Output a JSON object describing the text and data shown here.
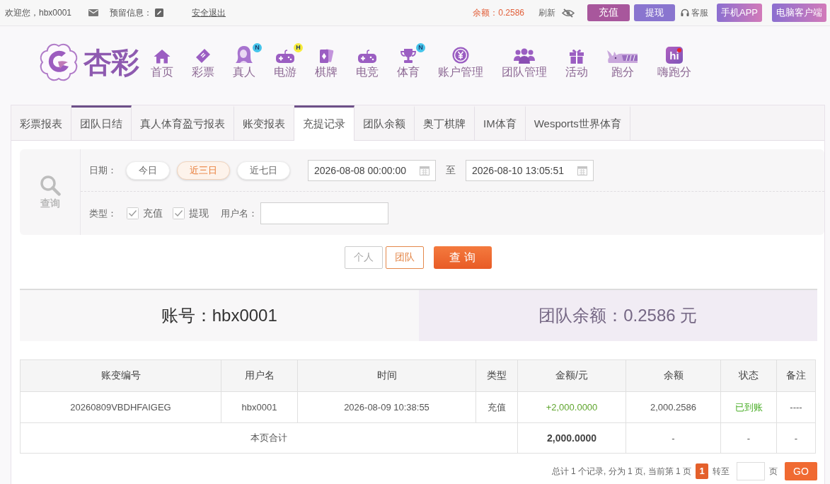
{
  "top_bar": {
    "welcome": "欢迎您，hbx0001",
    "message_label": "预留信息：",
    "logout": "安全退出",
    "balance": "余额：0.2586",
    "refresh": "刷新",
    "actions": [
      {
        "kind": "deposit",
        "label": "充值"
      },
      {
        "kind": "withdraw",
        "label": "提现"
      },
      {
        "kind": "support",
        "label": "客服"
      },
      {
        "kind": "app",
        "label": "手机APP"
      },
      {
        "kind": "app",
        "label": "电脑客户端"
      }
    ]
  },
  "logo": {
    "text": "杏彩"
  },
  "nav": [
    {
      "kind": "home",
      "label": "首页"
    },
    {
      "kind": "ticket",
      "label": "彩票"
    },
    {
      "kind": "live",
      "label": "真人",
      "badge": {
        "text": "N",
        "color": "#45c4ea"
      }
    },
    {
      "kind": "gamepad",
      "label": "电游",
      "badge": {
        "text": "H",
        "color": "#f7ec3a"
      }
    },
    {
      "kind": "cards",
      "label": "棋牌"
    },
    {
      "kind": "gamepad",
      "label": "电竞"
    },
    {
      "kind": "trophy",
      "label": "体育",
      "badge": {
        "text": "N",
        "color": "#45c4ea"
      }
    },
    {
      "kind": "coin",
      "label": "账户管理"
    },
    {
      "kind": "team",
      "label": "团队管理"
    },
    {
      "kind": "gift",
      "label": "活动"
    },
    {
      "kind": "rhino",
      "label": "跑分"
    },
    {
      "kind": "hi_app",
      "label": "嗨跑分",
      "icon_text": "hi"
    }
  ],
  "tabs": [
    {
      "label": "彩票报表",
      "selected": false,
      "hovered": false
    },
    {
      "label": "团队日结",
      "selected": false,
      "hovered": true
    },
    {
      "label": "真人体育盈亏报表",
      "selected": false,
      "hovered": false
    },
    {
      "label": "账变报表",
      "selected": false,
      "hovered": false
    },
    {
      "label": "充提记录",
      "selected": true,
      "hovered": false
    },
    {
      "label": "团队余额",
      "selected": false,
      "hovered": false
    },
    {
      "label": "奥丁棋牌",
      "selected": false,
      "hovered": false
    },
    {
      "label": "IM体育",
      "selected": false,
      "hovered": false
    },
    {
      "label": "Wesports世界体育",
      "selected": false,
      "hovered": false
    }
  ],
  "filter": {
    "panel_label": "查询",
    "date_label": "日期：",
    "presets": [
      {
        "label": "今日",
        "selected": false
      },
      {
        "label": "近三日",
        "selected": true
      },
      {
        "label": "近七日",
        "selected": false
      }
    ],
    "date_from": "2026-08-08 00:00:00",
    "range_separator": "至",
    "date_to": "2026-08-10 13:05:51",
    "type_label": "类型：",
    "types": [
      {
        "label": "充值",
        "checked": true
      },
      {
        "label": "提现",
        "checked": true
      }
    ],
    "user_label": "用户名："
  },
  "scope_buttons": [
    {
      "label": "个人",
      "selected": false
    },
    {
      "label": "团队",
      "selected": true
    }
  ],
  "submit": "查 询",
  "summary": {
    "account": "账号：hbx0001",
    "team_balance": "团队余额：0.2586 元"
  },
  "table": {
    "columns": [
      "账变编号",
      "用户名",
      "时间",
      "类型",
      "金额/元",
      "余额",
      "状态",
      "备注"
    ],
    "rows": [
      {
        "id": "20260809VBDHFAIGEG",
        "user": "hbx0001",
        "time": "2026-08-09 10:38:55",
        "type": "充值",
        "amount": {
          "text": "+2,000.0000",
          "kind": "credit"
        },
        "balance": "2,000.2586",
        "status": {
          "text": "已到账",
          "kind": "done"
        },
        "remark": "----"
      }
    ],
    "total": {
      "label": "本页合计",
      "amount": "2,000.0000",
      "balance": "-",
      "status": "-",
      "remark": "-"
    }
  },
  "pagination": {
    "summary": "总计 1 个记录, 分为 1 页, 当前第 1 页",
    "pages": [
      {
        "label": "1",
        "selected": true
      }
    ],
    "goto_label": "转至",
    "unit": "页",
    "go": "GO"
  }
}
